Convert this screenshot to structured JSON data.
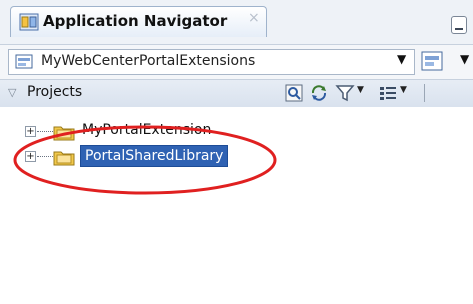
{
  "panel": {
    "title": "Application Navigator",
    "close_glyph": "×",
    "icons": {
      "tab": "application-navigator-icon",
      "minimize": "minimize-icon"
    }
  },
  "selector": {
    "value": "MyWebCenterPortalExtensions",
    "dropdown_glyph": "▼",
    "side_dropdown_glyph": "▼"
  },
  "projects": {
    "label": "Projects",
    "collapse_glyph": "▽",
    "toolbar_icons": [
      "search-icon",
      "refresh-icon",
      "filter-icon",
      "sort-icon"
    ],
    "arrow_glyph": "▼"
  },
  "tree": {
    "expander": "+",
    "items": [
      {
        "label": "MyPortalExtension",
        "selected": false
      },
      {
        "label": "PortalSharedLibrary",
        "selected": true
      }
    ]
  },
  "colors": {
    "selection": "#2f62b3",
    "annotation": "#e02020",
    "folder": "#f2c94c"
  }
}
